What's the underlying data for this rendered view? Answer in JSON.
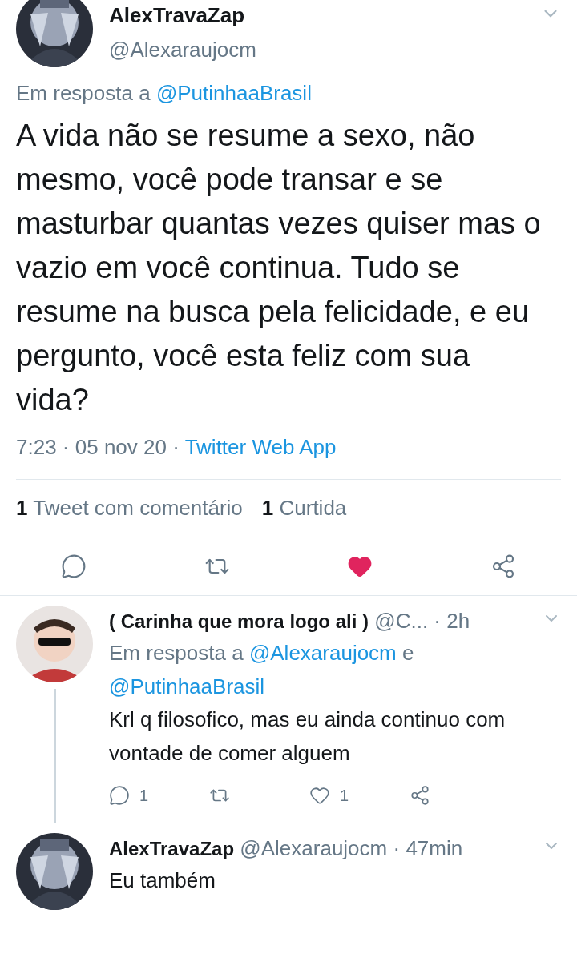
{
  "tweet": {
    "author": {
      "name": "AlexTravaZap",
      "handle": "@Alexaraujocm"
    },
    "reply_to": {
      "prefix": "Em resposta a",
      "mentions": [
        "@PutinhaaBrasil"
      ]
    },
    "text": "A vida não se resume a sexo, não mesmo, você pode transar e se masturbar quantas vezes quiser mas o vazio em você continua. Tudo se resume na busca pela felicidade, e eu pergunto, você esta feliz com sua vida?",
    "meta": {
      "parts": [
        "7:23",
        "05 nov 20"
      ],
      "source": "Twitter Web App",
      "separator": "·"
    },
    "stats": [
      {
        "count": "1",
        "label": "Tweet com comentário"
      },
      {
        "count": "1",
        "label": "Curtida"
      }
    ],
    "actions": [
      {
        "kind": "reply"
      },
      {
        "kind": "retweet"
      },
      {
        "kind": "like",
        "liked": true
      },
      {
        "kind": "share"
      }
    ]
  },
  "replies": [
    {
      "name": "( Carinha que mora logo ali )",
      "handle": "@C...",
      "separator": "·",
      "time": "2h",
      "reply_to": {
        "prefix": "Em resposta a",
        "mentions": [
          "@Alexaraujocm",
          "@PutinhaaBrasil"
        ],
        "joiner": "e"
      },
      "text": "Krl q filosofico, mas eu ainda continuo com vontade de comer alguem",
      "thread_continues": true,
      "actions": [
        {
          "kind": "reply",
          "count": "1"
        },
        {
          "kind": "retweet"
        },
        {
          "kind": "like",
          "liked": false,
          "count": "1"
        },
        {
          "kind": "share"
        }
      ]
    },
    {
      "name": "AlexTravaZap",
      "handle": "@Alexaraujocm",
      "separator": "·",
      "time": "47min",
      "text": "Eu também",
      "thread_continues": false
    }
  ]
}
